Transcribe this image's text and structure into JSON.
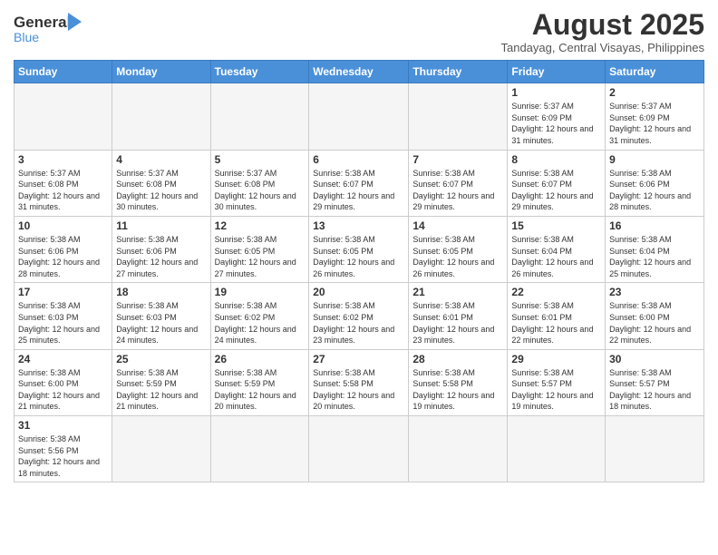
{
  "header": {
    "logo_text_general": "General",
    "logo_text_blue": "Blue",
    "month_title": "August 2025",
    "location": "Tandayag, Central Visayas, Philippines"
  },
  "weekdays": [
    "Sunday",
    "Monday",
    "Tuesday",
    "Wednesday",
    "Thursday",
    "Friday",
    "Saturday"
  ],
  "weeks": [
    [
      {
        "day": "",
        "info": ""
      },
      {
        "day": "",
        "info": ""
      },
      {
        "day": "",
        "info": ""
      },
      {
        "day": "",
        "info": ""
      },
      {
        "day": "",
        "info": ""
      },
      {
        "day": "1",
        "info": "Sunrise: 5:37 AM\nSunset: 6:09 PM\nDaylight: 12 hours and 31 minutes."
      },
      {
        "day": "2",
        "info": "Sunrise: 5:37 AM\nSunset: 6:09 PM\nDaylight: 12 hours and 31 minutes."
      }
    ],
    [
      {
        "day": "3",
        "info": "Sunrise: 5:37 AM\nSunset: 6:08 PM\nDaylight: 12 hours and 31 minutes."
      },
      {
        "day": "4",
        "info": "Sunrise: 5:37 AM\nSunset: 6:08 PM\nDaylight: 12 hours and 30 minutes."
      },
      {
        "day": "5",
        "info": "Sunrise: 5:37 AM\nSunset: 6:08 PM\nDaylight: 12 hours and 30 minutes."
      },
      {
        "day": "6",
        "info": "Sunrise: 5:38 AM\nSunset: 6:07 PM\nDaylight: 12 hours and 29 minutes."
      },
      {
        "day": "7",
        "info": "Sunrise: 5:38 AM\nSunset: 6:07 PM\nDaylight: 12 hours and 29 minutes."
      },
      {
        "day": "8",
        "info": "Sunrise: 5:38 AM\nSunset: 6:07 PM\nDaylight: 12 hours and 29 minutes."
      },
      {
        "day": "9",
        "info": "Sunrise: 5:38 AM\nSunset: 6:06 PM\nDaylight: 12 hours and 28 minutes."
      }
    ],
    [
      {
        "day": "10",
        "info": "Sunrise: 5:38 AM\nSunset: 6:06 PM\nDaylight: 12 hours and 28 minutes."
      },
      {
        "day": "11",
        "info": "Sunrise: 5:38 AM\nSunset: 6:06 PM\nDaylight: 12 hours and 27 minutes."
      },
      {
        "day": "12",
        "info": "Sunrise: 5:38 AM\nSunset: 6:05 PM\nDaylight: 12 hours and 27 minutes."
      },
      {
        "day": "13",
        "info": "Sunrise: 5:38 AM\nSunset: 6:05 PM\nDaylight: 12 hours and 26 minutes."
      },
      {
        "day": "14",
        "info": "Sunrise: 5:38 AM\nSunset: 6:05 PM\nDaylight: 12 hours and 26 minutes."
      },
      {
        "day": "15",
        "info": "Sunrise: 5:38 AM\nSunset: 6:04 PM\nDaylight: 12 hours and 26 minutes."
      },
      {
        "day": "16",
        "info": "Sunrise: 5:38 AM\nSunset: 6:04 PM\nDaylight: 12 hours and 25 minutes."
      }
    ],
    [
      {
        "day": "17",
        "info": "Sunrise: 5:38 AM\nSunset: 6:03 PM\nDaylight: 12 hours and 25 minutes."
      },
      {
        "day": "18",
        "info": "Sunrise: 5:38 AM\nSunset: 6:03 PM\nDaylight: 12 hours and 24 minutes."
      },
      {
        "day": "19",
        "info": "Sunrise: 5:38 AM\nSunset: 6:02 PM\nDaylight: 12 hours and 24 minutes."
      },
      {
        "day": "20",
        "info": "Sunrise: 5:38 AM\nSunset: 6:02 PM\nDaylight: 12 hours and 23 minutes."
      },
      {
        "day": "21",
        "info": "Sunrise: 5:38 AM\nSunset: 6:01 PM\nDaylight: 12 hours and 23 minutes."
      },
      {
        "day": "22",
        "info": "Sunrise: 5:38 AM\nSunset: 6:01 PM\nDaylight: 12 hours and 22 minutes."
      },
      {
        "day": "23",
        "info": "Sunrise: 5:38 AM\nSunset: 6:00 PM\nDaylight: 12 hours and 22 minutes."
      }
    ],
    [
      {
        "day": "24",
        "info": "Sunrise: 5:38 AM\nSunset: 6:00 PM\nDaylight: 12 hours and 21 minutes."
      },
      {
        "day": "25",
        "info": "Sunrise: 5:38 AM\nSunset: 5:59 PM\nDaylight: 12 hours and 21 minutes."
      },
      {
        "day": "26",
        "info": "Sunrise: 5:38 AM\nSunset: 5:59 PM\nDaylight: 12 hours and 20 minutes."
      },
      {
        "day": "27",
        "info": "Sunrise: 5:38 AM\nSunset: 5:58 PM\nDaylight: 12 hours and 20 minutes."
      },
      {
        "day": "28",
        "info": "Sunrise: 5:38 AM\nSunset: 5:58 PM\nDaylight: 12 hours and 19 minutes."
      },
      {
        "day": "29",
        "info": "Sunrise: 5:38 AM\nSunset: 5:57 PM\nDaylight: 12 hours and 19 minutes."
      },
      {
        "day": "30",
        "info": "Sunrise: 5:38 AM\nSunset: 5:57 PM\nDaylight: 12 hours and 18 minutes."
      }
    ],
    [
      {
        "day": "31",
        "info": "Sunrise: 5:38 AM\nSunset: 5:56 PM\nDaylight: 12 hours and 18 minutes."
      },
      {
        "day": "",
        "info": ""
      },
      {
        "day": "",
        "info": ""
      },
      {
        "day": "",
        "info": ""
      },
      {
        "day": "",
        "info": ""
      },
      {
        "day": "",
        "info": ""
      },
      {
        "day": "",
        "info": ""
      }
    ]
  ]
}
